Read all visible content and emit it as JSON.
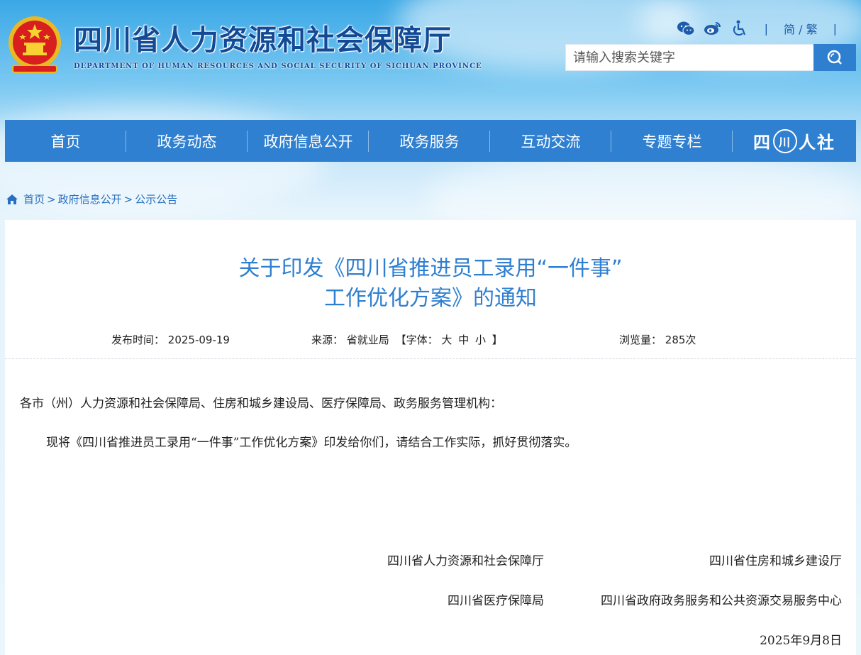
{
  "header": {
    "title": "四川省人力资源和社会保障厅",
    "subtitle": "DEPARTMENT OF HUMAN RESOURCES AND SOCIAL SECURITY OF SICHUAN PROVINCE",
    "tools": [
      "wechat-icon",
      "weibo-icon",
      "accessibility-icon"
    ],
    "lang_simplified": "简",
    "lang_slash": "/",
    "lang_traditional": "繁",
    "separator": "|"
  },
  "search": {
    "placeholder": "请输入搜索关键字"
  },
  "nav": {
    "items": [
      "首页",
      "政务动态",
      "政府信息公开",
      "政务服务",
      "互动交流",
      "专题专栏"
    ],
    "brand_left": "四",
    "brand_ring": "川",
    "brand_right": "人社"
  },
  "breadcrumb": {
    "items": [
      "首页",
      "政府信息公开",
      "公示公告"
    ],
    "sep": ">"
  },
  "article": {
    "title_line1": "关于印发《四川省推进员工录用“一件事”",
    "title_line2": "工作优化方案》的通知",
    "publish_label": "发布时间：",
    "publish_date": "2025-09-19",
    "source_label": "来源：",
    "source_value": "省就业局",
    "font_label": "【字体：",
    "font_large": "大",
    "font_medium": "中",
    "font_small": "小",
    "font_close": "】",
    "views_label": "浏览量：",
    "views_value": "285次",
    "recipients": "各市（州）人力资源和社会保障局、住房和城乡建设局、医疗保障局、政务服务管理机构：",
    "paragraph": "现将《四川省推进员工录用“一件事”工作优化方案》印发给你们，请结合工作实际，抓好贯彻落实。",
    "signers": [
      "四川省人力资源和社会保障厅",
      "四川省住房和城乡建设厅",
      "四川省医疗保障局",
      "四川省政府政务服务和公共资源交易服务中心"
    ],
    "date": "2025年9月8日"
  },
  "colors": {
    "nav_bg": "#2f80d1",
    "title_blue": "#2f7fd0",
    "header_blue": "#124a96"
  }
}
